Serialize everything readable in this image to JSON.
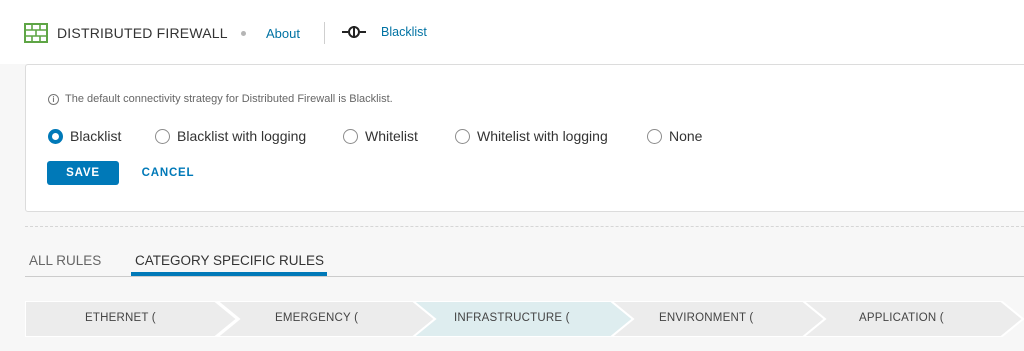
{
  "header": {
    "title": "DISTRIBUTED FIREWALL",
    "about_label": "About",
    "strategy_link": "Blacklist",
    "icon": "firewall-brick-icon",
    "connector_icon": "connectivity-icon"
  },
  "strategy_card": {
    "info_text": "The default connectivity strategy for Distributed Firewall is Blacklist.",
    "options": [
      {
        "label": "Blacklist",
        "selected": true
      },
      {
        "label": "Blacklist with logging",
        "selected": false
      },
      {
        "label": "Whitelist",
        "selected": false
      },
      {
        "label": "Whitelist with logging",
        "selected": false
      },
      {
        "label": "None",
        "selected": false
      }
    ],
    "save_label": "SAVE",
    "cancel_label": "CANCEL"
  },
  "tabs": [
    {
      "label": "ALL RULES",
      "active": false
    },
    {
      "label": "CATEGORY SPECIFIC RULES",
      "active": true
    }
  ],
  "categories": [
    {
      "label": "ETHERNET (",
      "active": false
    },
    {
      "label": "EMERGENCY (",
      "active": false
    },
    {
      "label": "INFRASTRUCTURE (",
      "active": true
    },
    {
      "label": "ENVIRONMENT (",
      "active": false
    },
    {
      "label": "APPLICATION (",
      "active": false
    }
  ],
  "colors": {
    "accent": "#0079b8",
    "link": "#0072a3",
    "icon_green": "#5ea545",
    "step_default": "#ececec",
    "step_active": "#deedef"
  }
}
